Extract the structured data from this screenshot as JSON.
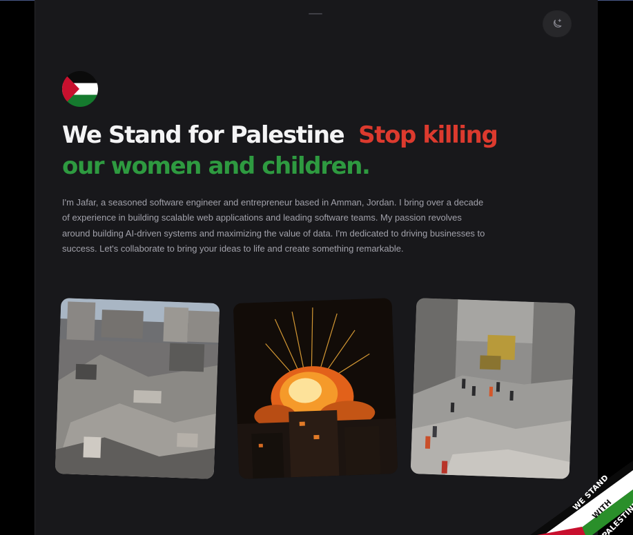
{
  "hero": {
    "headline_white": "We Stand for Palestine",
    "headline_red": "Stop killing",
    "headline_green": "our women and children.",
    "intro": "I'm Jafar, a seasoned software engineer and entrepreneur based in Amman, Jordan. I bring over a decade of experience in building scalable web applications and leading software teams. My passion revolves around building AI-driven systems and maximizing the value of data. I'm dedicated to driving businesses to success. Let's collaborate to bring your ideas to life and create something remarkable."
  },
  "header": {
    "theme_toggle_icon": "moon-sparkle-icon"
  },
  "photos": [
    {
      "icon": "destroyed-buildings-photo"
    },
    {
      "icon": "explosion-photo"
    },
    {
      "icon": "rubble-street-photo"
    }
  ],
  "ribbon": {
    "line1": "WE STAND",
    "line2": "WITH",
    "line3": "PALESTINE"
  },
  "colors": {
    "background": "#18181b",
    "accent_red": "#dc3a2e",
    "accent_green": "#2e9a40",
    "text_muted": "#a1a1aa",
    "text_main": "#f4f4f5"
  }
}
